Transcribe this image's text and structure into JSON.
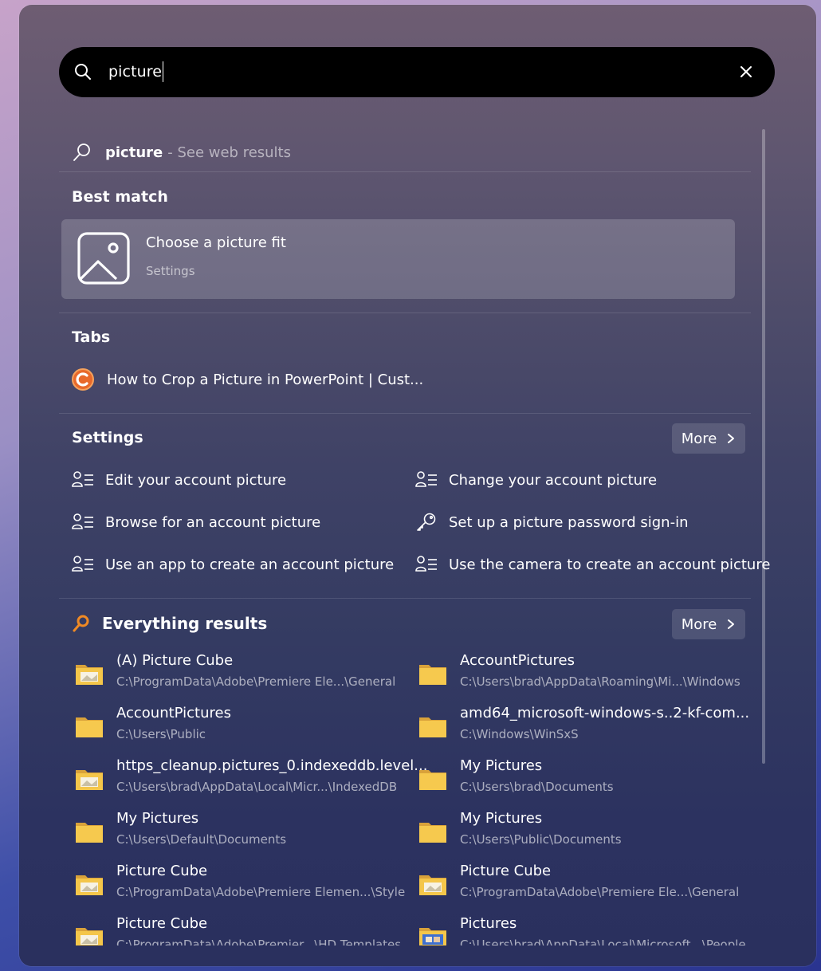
{
  "search": {
    "query": "picture",
    "icon": "search-icon",
    "clear_icon": "close-icon"
  },
  "web_result": {
    "term": "picture",
    "suffix": "- See web results"
  },
  "best_match": {
    "heading": "Best match",
    "title": "Choose a picture fit",
    "subtitle": "Settings",
    "icon": "picture-icon"
  },
  "tabs": {
    "heading": "Tabs",
    "items": [
      {
        "label": "How to Crop a Picture in PowerPoint | Cust...",
        "icon": "site-favicon-icon"
      }
    ]
  },
  "settings": {
    "heading": "Settings",
    "more_label": "More",
    "items": [
      {
        "label": "Edit your account picture",
        "icon": "account-settings-icon"
      },
      {
        "label": "Change your account picture",
        "icon": "account-settings-icon"
      },
      {
        "label": "Browse for an account picture",
        "icon": "account-settings-icon"
      },
      {
        "label": "Set up a picture password sign-in",
        "icon": "key-icon"
      },
      {
        "label": "Use an app to create an account picture",
        "icon": "account-settings-icon"
      },
      {
        "label": "Use the camera to create an account picture",
        "icon": "account-settings-icon"
      }
    ]
  },
  "everything": {
    "heading": "Everything results",
    "more_label": "More",
    "items": [
      {
        "name": "(A) Picture Cube",
        "path": "C:\\ProgramData\\Adobe\\Premiere Ele...\\General",
        "icon": "folder-image-icon"
      },
      {
        "name": "AccountPictures",
        "path": "C:\\Users\\brad\\AppData\\Roaming\\Mi...\\Windows",
        "icon": "folder-icon"
      },
      {
        "name": "AccountPictures",
        "path": "C:\\Users\\Public",
        "icon": "folder-icon"
      },
      {
        "name": "amd64_microsoft-windows-s..2-kf-com...",
        "path": "C:\\Windows\\WinSxS",
        "icon": "folder-icon"
      },
      {
        "name": "https_cleanup.pictures_0.indexeddb.level...",
        "path": "C:\\Users\\brad\\AppData\\Local\\Micr...\\IndexedDB",
        "icon": "folder-image-icon"
      },
      {
        "name": "My Pictures",
        "path": "C:\\Users\\brad\\Documents",
        "icon": "folder-icon"
      },
      {
        "name": "My Pictures",
        "path": "C:\\Users\\Default\\Documents",
        "icon": "folder-icon"
      },
      {
        "name": "My Pictures",
        "path": "C:\\Users\\Public\\Documents",
        "icon": "folder-icon"
      },
      {
        "name": "Picture Cube",
        "path": "C:\\ProgramData\\Adobe\\Premiere Elemen...\\Style",
        "icon": "folder-image-icon"
      },
      {
        "name": "Picture Cube",
        "path": "C:\\ProgramData\\Adobe\\Premiere Ele...\\General",
        "icon": "folder-image-icon"
      },
      {
        "name": "Picture Cube",
        "path": "C:\\ProgramData\\Adobe\\Premier...\\HD Templates",
        "icon": "folder-image-icon"
      },
      {
        "name": "Pictures",
        "path": "C:\\Users\\brad\\AppData\\Local\\Microsoft...\\People",
        "icon": "folder-image-icon"
      }
    ]
  }
}
